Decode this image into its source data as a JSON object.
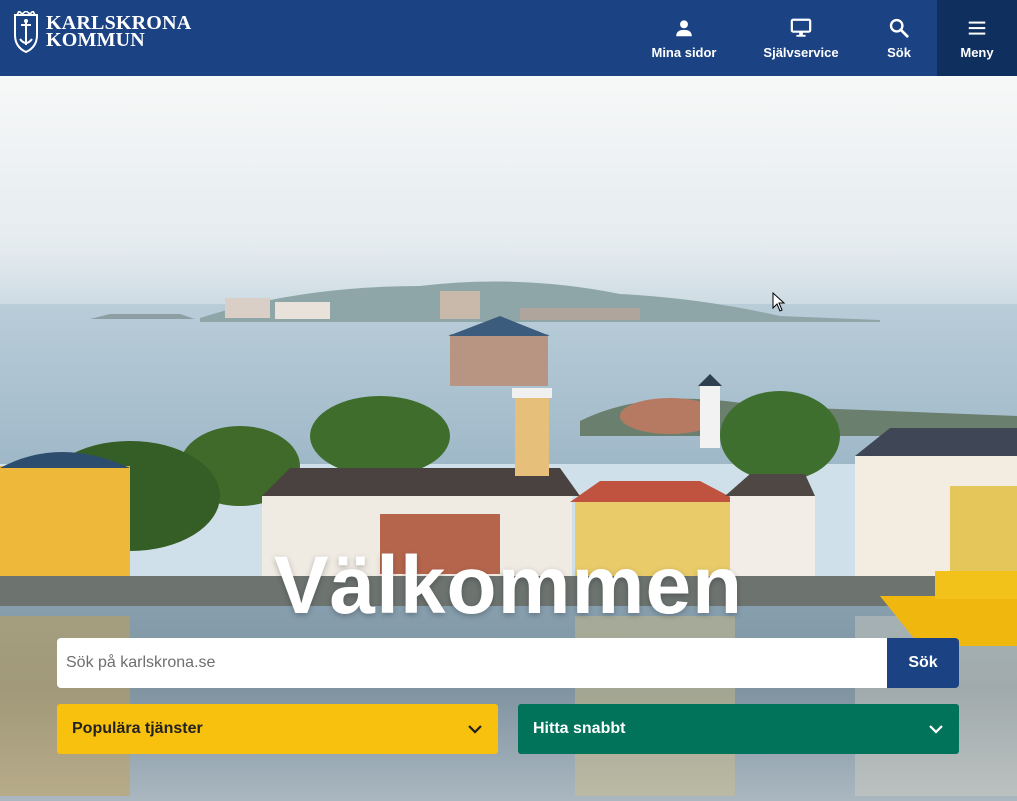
{
  "header": {
    "logo_line1": "KARLSKRONA",
    "logo_line2": "KOMMUN",
    "nav": [
      {
        "label": "Mina sidor",
        "icon": "person-icon"
      },
      {
        "label": "Självservice",
        "icon": "monitor-icon"
      },
      {
        "label": "Sök",
        "icon": "search-icon"
      },
      {
        "label": "Meny",
        "icon": "hamburger-icon"
      }
    ]
  },
  "hero": {
    "heading": "Välkommen",
    "search": {
      "placeholder": "Sök på karlskrona.se",
      "button_label": "Sök"
    },
    "dropdowns": [
      {
        "label": "Populära tjänster"
      },
      {
        "label": "Hitta snabbt"
      }
    ]
  },
  "colors": {
    "header_bg": "#1b4383",
    "menu_bg": "#0f2f5e",
    "popular_bg": "#f8c10e",
    "quick_bg": "#00735a"
  }
}
